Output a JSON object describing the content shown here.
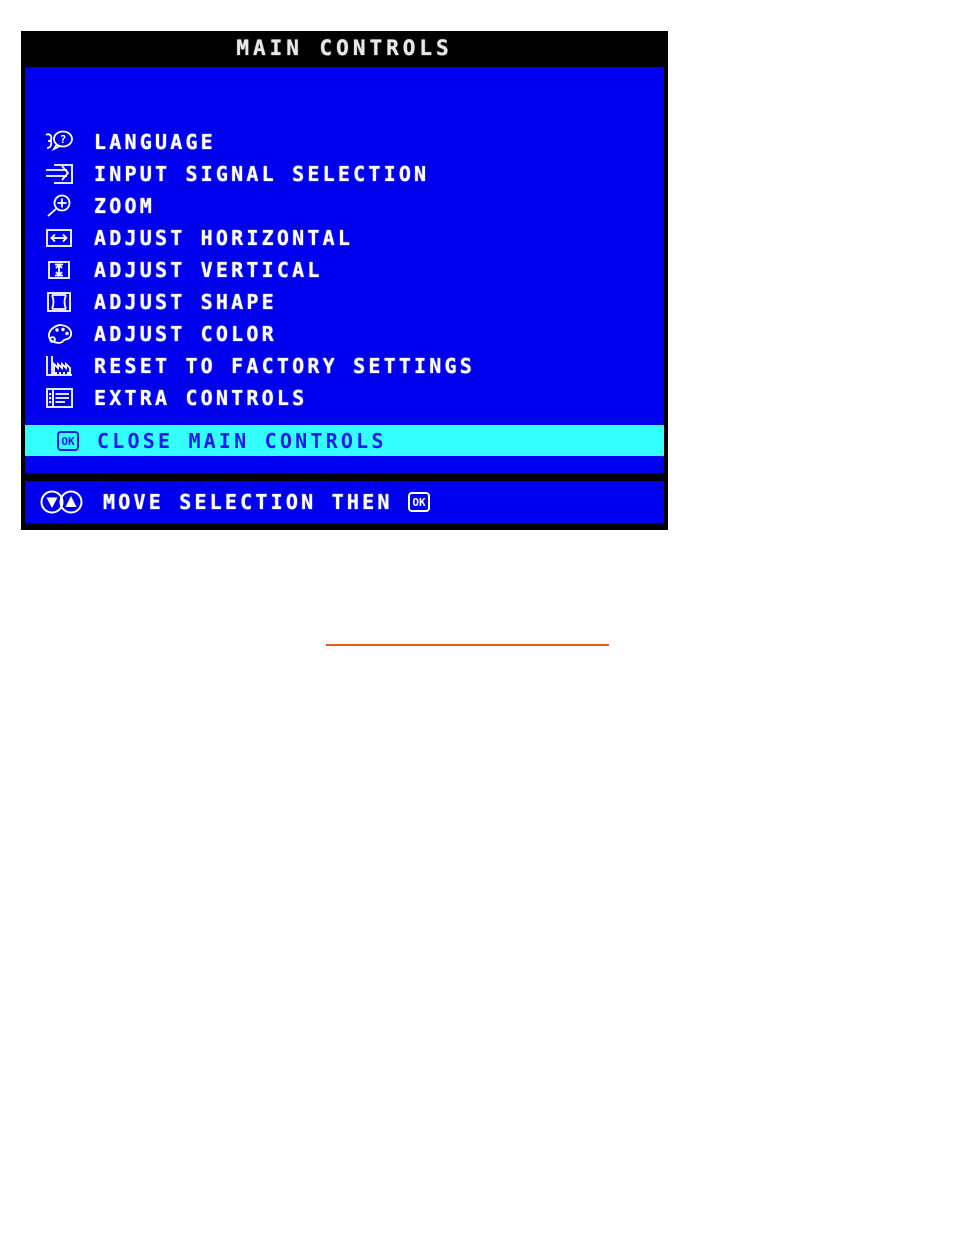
{
  "osd": {
    "title": "MAIN CONTROLS",
    "colors": {
      "panel_border": "#000000",
      "body_background": "#0000f0",
      "title_text": "#e8e8e8",
      "menu_text": "#ffffff",
      "highlight_background": "#33ffff",
      "highlight_text": "#1a1aee",
      "rule_orange": "#e8591c"
    },
    "menu_items": [
      {
        "icon": "language-face-question-icon",
        "label": "LANGUAGE"
      },
      {
        "icon": "input-signal-arrow-into-box-icon",
        "label": "INPUT SIGNAL SELECTION"
      },
      {
        "icon": "zoom-magnifier-plus-icon",
        "label": "ZOOM"
      },
      {
        "icon": "adjust-horizontal-left-right-arrow-icon",
        "label": "ADJUST HORIZONTAL"
      },
      {
        "icon": "adjust-vertical-up-down-arrow-icon",
        "label": "ADJUST VERTICAL"
      },
      {
        "icon": "adjust-shape-pincushion-icon",
        "label": "ADJUST SHAPE"
      },
      {
        "icon": "adjust-color-palette-icon",
        "label": "ADJUST COLOR"
      },
      {
        "icon": "reset-factory-building-icon",
        "label": "RESET TO FACTORY SETTINGS"
      },
      {
        "icon": "extra-controls-list-icon",
        "label": "EXTRA CONTROLS"
      }
    ],
    "close_item": {
      "icon": "ok-button-icon",
      "label": "CLOSE MAIN CONTROLS",
      "selected": true
    },
    "footer": {
      "icons": [
        "arrow-down-circle-icon",
        "arrow-up-circle-icon"
      ],
      "label": "MOVE SELECTION THEN",
      "trailing_icon": "ok-button-icon"
    }
  }
}
